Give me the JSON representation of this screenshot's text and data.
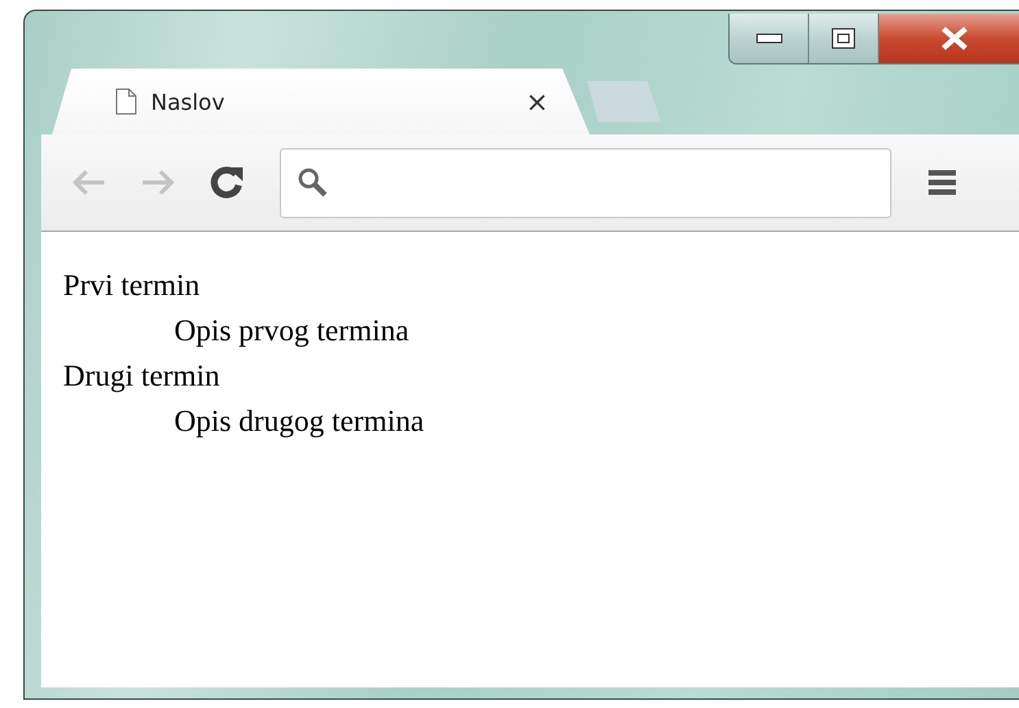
{
  "tabs": [
    {
      "title": "Naslov",
      "close": "×",
      "selected": true
    }
  ],
  "toolbar": {
    "back_disabled": true,
    "forward_disabled": true
  },
  "definitions": [
    {
      "term": "Prvi termin",
      "description": "Opis prvog termina"
    },
    {
      "term": "Drugi termin",
      "description": "Opis drugog termina"
    }
  ]
}
